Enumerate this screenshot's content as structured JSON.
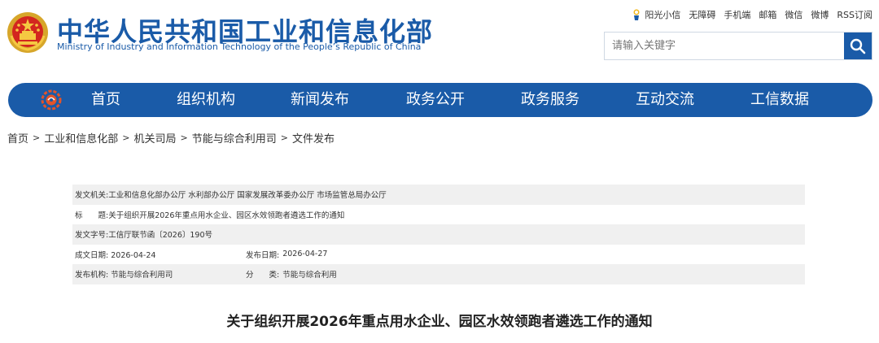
{
  "header": {
    "title_cn": "中华人民共和国工业和信息化部",
    "title_en": "Ministry of Industry and Information Technology of the People’s Republic of China",
    "toplinks": [
      "阳光小信",
      "无障碍",
      "手机端",
      "邮箱",
      "微信",
      "微博",
      "RSS订阅"
    ],
    "search_placeholder": "请输入关键字",
    "brand_color": "#1a5ba8"
  },
  "nav": {
    "items": [
      "首页",
      "组织机构",
      "新闻发布",
      "政务公开",
      "政务服务",
      "互动交流",
      "工信数据"
    ]
  },
  "breadcrumb": [
    "首页",
    "工业和信息化部",
    "机关司局",
    "节能与综合利用司",
    "文件发布"
  ],
  "info": {
    "issuer_label": "发文机关:",
    "issuer_value": "工业和信息化部办公厅 水利部办公厅 国家发展改革委办公厅 市场监管总局办公厅",
    "title_label": "标　　题:",
    "title_value": "关于组织开展2026年重点用水企业、园区水效领跑者遴选工作的通知",
    "docno_label": "发文字号:",
    "docno_value": "工信厅联节函〔2026〕190号",
    "created_label": "成文日期:",
    "created_value": "2026-04-24",
    "published_label": "发布日期:",
    "published_value": "2026-04-27",
    "org_label": "发布机构:",
    "org_value": "节能与综合利用司",
    "category_label": "分　　类:",
    "category_value": "节能与综合利用"
  },
  "doc_title": "关于组织开展2026年重点用水企业、园区水效领跑者遴选工作的通知"
}
